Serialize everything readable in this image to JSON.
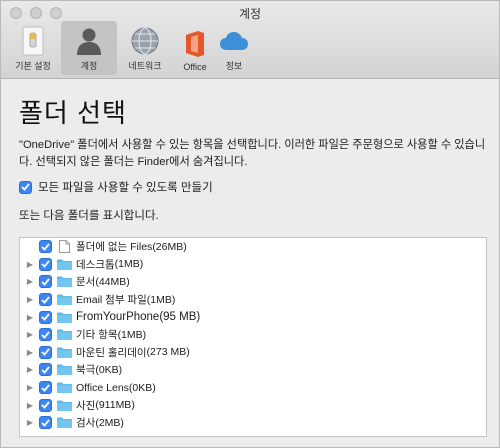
{
  "window": {
    "title": "계정"
  },
  "toolbar": {
    "items": [
      {
        "label": "기본 설정",
        "icon": "switch-icon"
      },
      {
        "label": "계정",
        "icon": "person-icon",
        "selected": true
      },
      {
        "label": "네트워크",
        "icon": "globe-icon"
      },
      {
        "label": "Office",
        "icon": "office-icon"
      },
      {
        "label": "정보",
        "icon": "cloud-icon"
      }
    ]
  },
  "main": {
    "heading": "폴더 선택",
    "description": "\"OneDrive\" 폴더에서 사용할 수 있는 항목을 선택합니다. 이러한 파일은 주문형으로 사용할 수 있습니다. 선택되지 않은 폴더는 Finder에서 숨겨집니다.",
    "all_files_label": "모든 파일을 사용할 수 있도록 만들기",
    "show_folders_label": "또는 다음 폴더를 표시합니다."
  },
  "folders": [
    {
      "name": "폴더에 없는 Files",
      "size": "(26MB)",
      "type": "file",
      "expandable": false,
      "checked": true
    },
    {
      "name": "데스크톱",
      "size": "(1MB)",
      "type": "folder",
      "expandable": true,
      "checked": true
    },
    {
      "name": "문서",
      "size": "(44MB)",
      "type": "folder",
      "expandable": true,
      "checked": true
    },
    {
      "name": "Email 첨부 파일",
      "size": "(1MB)",
      "type": "folder",
      "expandable": true,
      "checked": true
    },
    {
      "name": "FromYourPhone",
      "size": " (95 MB)",
      "type": "folder",
      "expandable": true,
      "checked": true,
      "large": true
    },
    {
      "name": "기타 항목",
      "size": "(1MB)",
      "type": "folder",
      "expandable": true,
      "checked": true
    },
    {
      "name": "마운틴 홀리데이",
      "size": " (273 MB)",
      "type": "folder",
      "expandable": true,
      "checked": true
    },
    {
      "name": "북극",
      "size": "(0KB)",
      "type": "folder",
      "expandable": true,
      "checked": true
    },
    {
      "name": "Office Lens",
      "size": "(0KB)",
      "type": "folder",
      "expandable": true,
      "checked": true
    },
    {
      "name": "사진",
      "size": "(911MB)",
      "type": "folder",
      "expandable": true,
      "checked": true
    },
    {
      "name": "검사",
      "size": "(2MB)",
      "type": "folder",
      "expandable": true,
      "checked": true
    }
  ],
  "colors": {
    "accent": "#3b86f4",
    "folder": "#5fb8ea"
  }
}
